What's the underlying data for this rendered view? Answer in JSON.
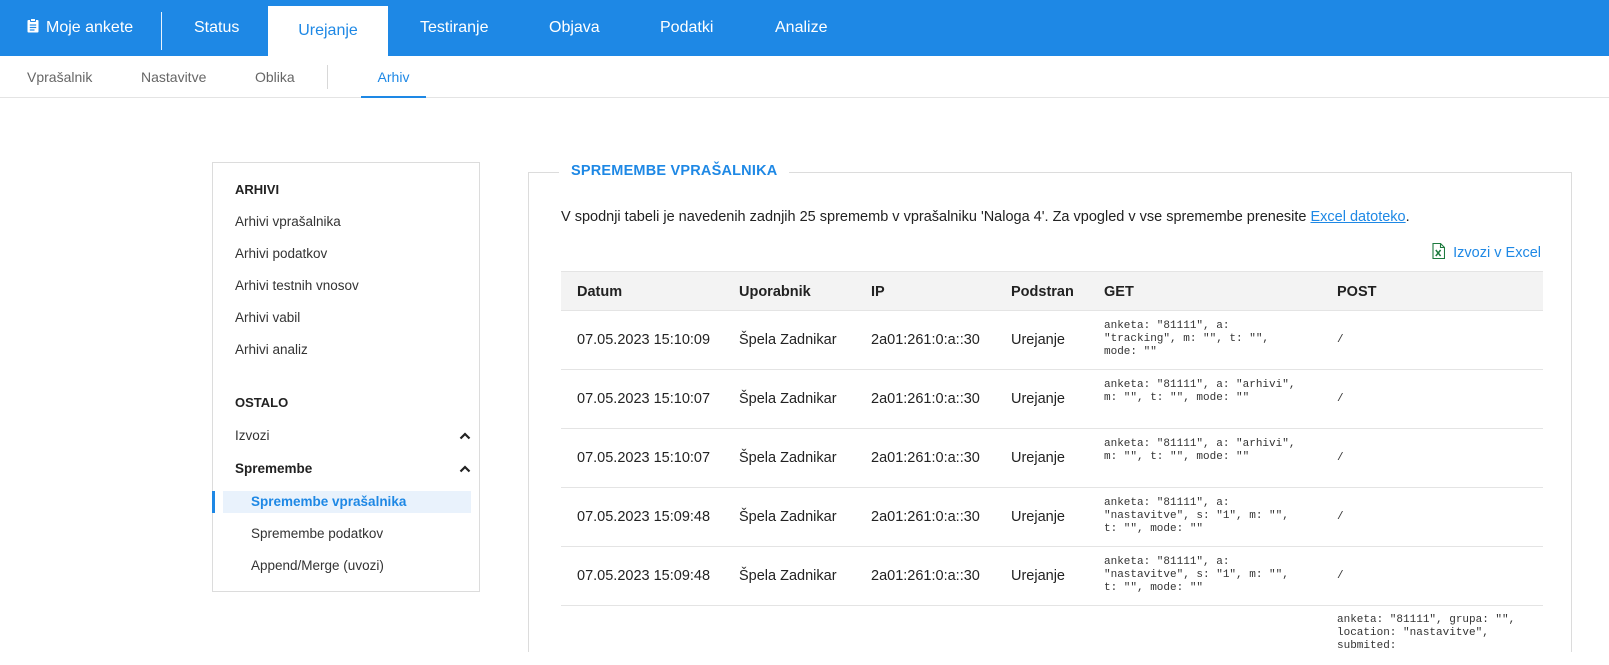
{
  "topnav": {
    "brand": "Moje ankete",
    "tabs": [
      {
        "label": "Status"
      },
      {
        "label": "Urejanje"
      },
      {
        "label": "Testiranje"
      },
      {
        "label": "Objava"
      },
      {
        "label": "Podatki"
      },
      {
        "label": "Analize"
      }
    ],
    "active_tab": "Urejanje"
  },
  "subnav": {
    "tabs": [
      {
        "label": "Vprašalnik"
      },
      {
        "label": "Nastavitve"
      },
      {
        "label": "Oblika"
      },
      {
        "label": "Arhiv"
      }
    ],
    "active_tab": "Arhiv"
  },
  "sidebar": {
    "archives_heading": "ARHIVI",
    "archives": [
      {
        "label": "Arhivi vprašalnika"
      },
      {
        "label": "Arhivi podatkov"
      },
      {
        "label": "Arhivi testnih vnosov"
      },
      {
        "label": "Arhivi vabil"
      },
      {
        "label": "Arhivi analiz"
      }
    ],
    "other_heading": "OSTALO",
    "groups": [
      {
        "label": "Izvozi"
      },
      {
        "label": "Spremembe"
      }
    ],
    "changes_items": [
      {
        "label": "Spremembe vprašalnika"
      },
      {
        "label": "Spremembe podatkov"
      },
      {
        "label": "Append/Merge (uvozi)"
      }
    ],
    "active_item": "Spremembe vprašalnika"
  },
  "main": {
    "title": "SPREMEMBE VPRAŠALNIKA",
    "intro": "V spodnji tabeli je navedenih zadnjih 25 sprememb v vprašalniku 'Naloga 4'. Za vpogled v vse spremembe prenesite ",
    "intro_link": "Excel datoteko",
    "intro_end": ".",
    "export_label": "Izvozi v Excel",
    "columns": [
      "Datum",
      "Uporabnik",
      "IP",
      "Podstran",
      "GET",
      "POST"
    ],
    "rows": [
      {
        "datum": "07.05.2023 15:10:09",
        "uporabnik": "Špela Zadnikar",
        "ip": "2a01:261:0:a::30",
        "podstran": "Urejanje",
        "get": "anketa: \"81111\", a: \"tracking\", m: \"\", t: \"\", mode: \"\"",
        "post": "/"
      },
      {
        "datum": "07.05.2023 15:10:07",
        "uporabnik": "Špela Zadnikar",
        "ip": "2a01:261:0:a::30",
        "podstran": "Urejanje",
        "get": "anketa: \"81111\", a: \"arhivi\", m: \"\", t: \"\", mode: \"\"",
        "post": "/"
      },
      {
        "datum": "07.05.2023 15:10:07",
        "uporabnik": "Špela Zadnikar",
        "ip": "2a01:261:0:a::30",
        "podstran": "Urejanje",
        "get": "anketa: \"81111\", a: \"arhivi\", m: \"\", t: \"\", mode: \"\"",
        "post": "/"
      },
      {
        "datum": "07.05.2023 15:09:48",
        "uporabnik": "Špela Zadnikar",
        "ip": "2a01:261:0:a::30",
        "podstran": "Urejanje",
        "get": "anketa: \"81111\", a: \"nastavitve\", s: \"1\", m: \"\", t: \"\", mode: \"\"",
        "post": "/"
      },
      {
        "datum": "07.05.2023 15:09:48",
        "uporabnik": "Špela Zadnikar",
        "ip": "2a01:261:0:a::30",
        "podstran": "Urejanje",
        "get": "anketa: \"81111\", a: \"nastavitve\", s: \"1\", m: \"\", t: \"\", mode: \"\"",
        "post": "/"
      },
      {
        "datum": "",
        "uporabnik": "",
        "ip": "",
        "podstran": "",
        "get": "",
        "post": "anketa: \"81111\", grupa: \"\", location: \"nastavitve\", submited:"
      }
    ]
  },
  "colors": {
    "accent": "#1e88e5",
    "excel_green": "#1d7a3e"
  }
}
